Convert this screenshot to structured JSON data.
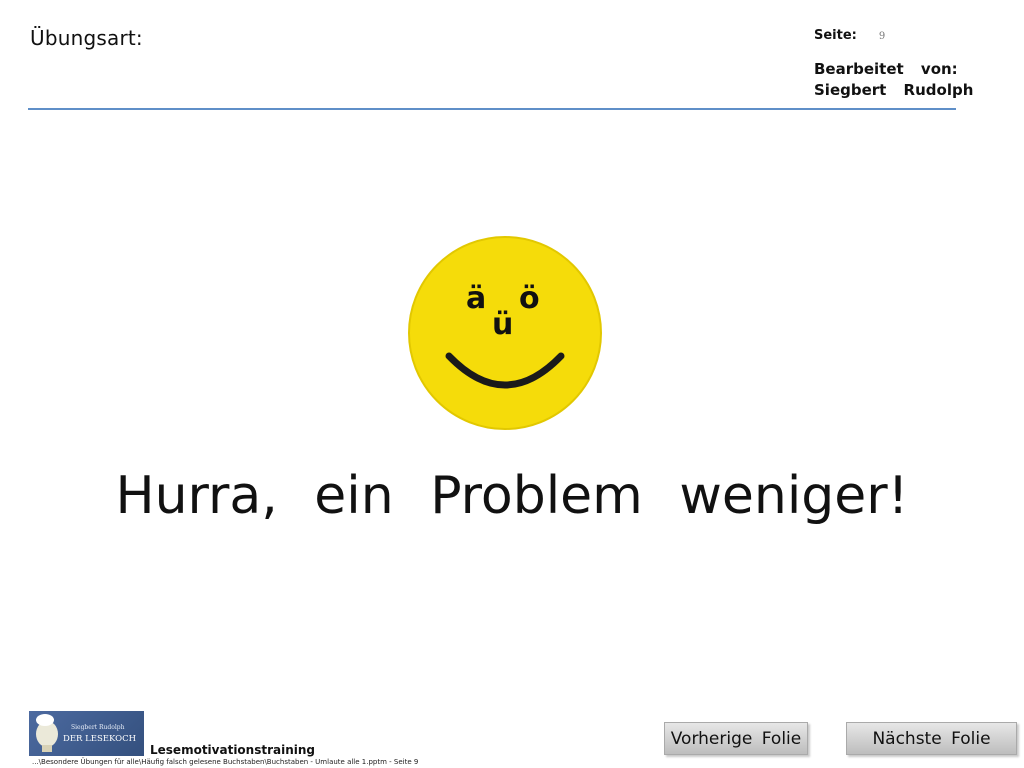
{
  "header": {
    "exercise_type_label": "Übungsart:",
    "page_label": "Seite:",
    "page_number": "9",
    "edited_by_label": "Bearbeitet von:",
    "editor_name": "Siegbert Rudolph"
  },
  "smiley": {
    "letters": [
      "ä",
      "ö",
      "ü"
    ],
    "face_color": "#f5dc0a",
    "icon": "smiley-face-icon"
  },
  "main": {
    "message": "Hurra, ein Problem weniger!"
  },
  "footer": {
    "logo": {
      "text_line1": "Siegbert Rudolph",
      "text_line2": "DER LESEKOCH",
      "icon": "lightbulb-chef-icon"
    },
    "title": "Lesemotivationstraining",
    "path": "...\\Besondere Übungen für alle\\Häufig falsch gelesene Buchstaben\\Buchstaben - Umlaute alle 1.pptm - Seite 9"
  },
  "navigation": {
    "prev_label": "Vorherige Folie",
    "next_label": "Nächste Folie"
  },
  "colors": {
    "header_line": "#5f8fc8",
    "button_gradient_top": "#e7e7e7",
    "button_gradient_bottom": "#bdbdbd",
    "logo_background": "#4c6aa0"
  }
}
